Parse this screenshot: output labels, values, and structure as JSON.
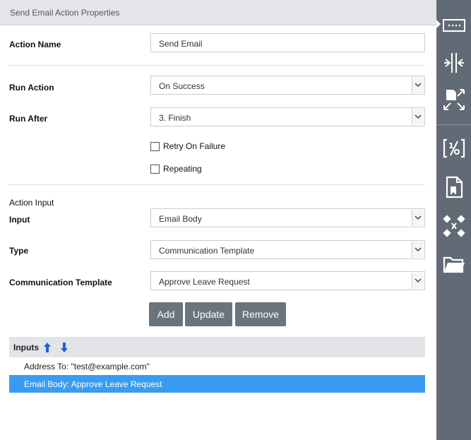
{
  "panel": {
    "title": "Send Email Action Properties"
  },
  "action_name": {
    "label": "Action Name",
    "value": "Send Email"
  },
  "run_action": {
    "label": "Run Action",
    "value": "On Success"
  },
  "run_after": {
    "label": "Run After",
    "value": "3. Finish"
  },
  "retry": {
    "label": "Retry On Failure"
  },
  "repeating": {
    "label": "Repeating"
  },
  "action_input": {
    "section_label": "Action Input",
    "input_label": "Input",
    "input_value": "Email Body",
    "type_label": "Type",
    "type_value": "Communication Template",
    "template_label": "Communication Template",
    "template_value": "Approve Leave Request"
  },
  "buttons": {
    "add": "Add",
    "update": "Update",
    "remove": "Remove"
  },
  "inputs_list": {
    "title": "Inputs",
    "items": [
      {
        "text": "Address To: \"test@example.com\""
      },
      {
        "text": "Email Body: Approve Leave Request"
      }
    ]
  },
  "colors": {
    "rail": "#626a76",
    "selected": "#3a9cf0",
    "button": "#6b737d"
  },
  "rail_icons": [
    "textbox-icon",
    "merge-arrows-icon",
    "expand-icon",
    "formula-icon",
    "document-bookmark-icon",
    "network-nodes-icon",
    "folder-icon"
  ]
}
